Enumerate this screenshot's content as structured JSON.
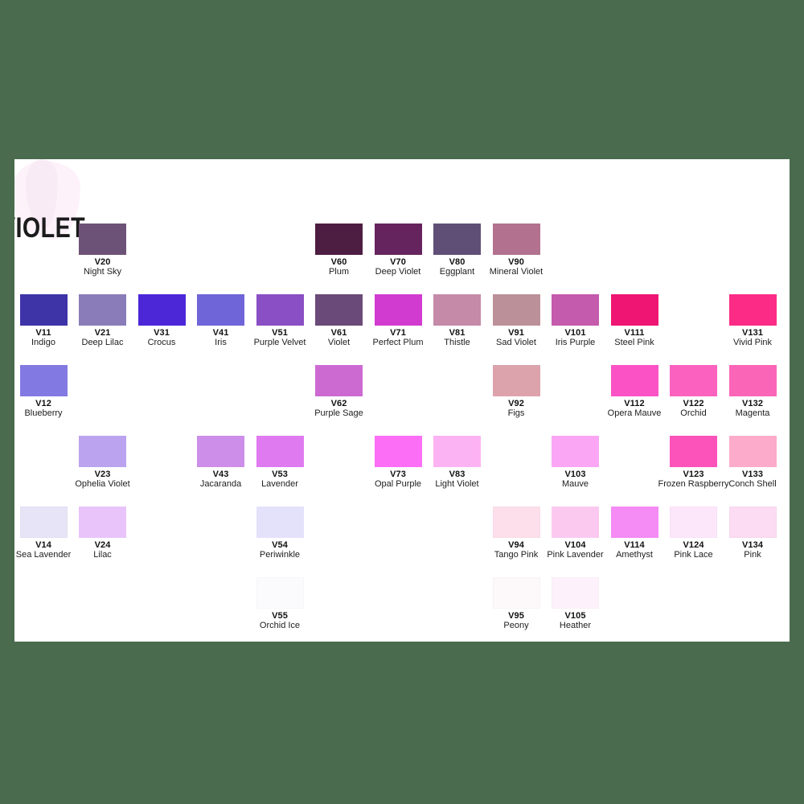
{
  "page": {
    "background_color": "#4a6b4e",
    "card_color": "#ffffff"
  },
  "heading": {
    "text": "VIOLET",
    "color": "#1b1b1b",
    "note": "clipped at left card edge"
  },
  "layout": {
    "columns": 12,
    "rows": 6,
    "chip_width": 59,
    "chip_height": 39,
    "col_pitch": 73.5,
    "row_pitch": 88
  },
  "swatches": [
    {
      "code": "V20",
      "name": "Night Sky",
      "hex": "#6d5277",
      "col": 1,
      "row": 0
    },
    {
      "code": "V60",
      "name": "Plum",
      "hex": "#4e1d42",
      "col": 5,
      "row": 0
    },
    {
      "code": "V70",
      "name": "Deep Violet",
      "hex": "#66245e",
      "col": 6,
      "row": 0
    },
    {
      "code": "V80",
      "name": "Eggplant",
      "hex": "#5f4f77",
      "col": 7,
      "row": 0
    },
    {
      "code": "V90",
      "name": "Mineral Violet",
      "hex": "#b1718f",
      "col": 8,
      "row": 0
    },
    {
      "code": "V11",
      "name": "Indigo",
      "hex": "#3e34a8",
      "col": 0,
      "row": 1
    },
    {
      "code": "V21",
      "name": "Deep Lilac",
      "hex": "#8a7cb8",
      "col": 1,
      "row": 1
    },
    {
      "code": "V31",
      "name": "Crocus",
      "hex": "#4b27d8",
      "col": 2,
      "row": 1
    },
    {
      "code": "V41",
      "name": "Iris",
      "hex": "#6f64d8",
      "col": 3,
      "row": 1
    },
    {
      "code": "V51",
      "name": "Purple Velvet",
      "hex": "#8a4fc4",
      "col": 4,
      "row": 1
    },
    {
      "code": "V61",
      "name": "Violet",
      "hex": "#6a4a78",
      "col": 5,
      "row": 1
    },
    {
      "code": "V71",
      "name": "Perfect Plum",
      "hex": "#d23bd0",
      "col": 6,
      "row": 1
    },
    {
      "code": "V81",
      "name": "Thistle",
      "hex": "#c58aa7",
      "col": 7,
      "row": 1
    },
    {
      "code": "V91",
      "name": "Sad Violet",
      "hex": "#bb9098",
      "col": 8,
      "row": 1
    },
    {
      "code": "V101",
      "name": "Iris Purple",
      "hex": "#c45bad",
      "col": 9,
      "row": 1
    },
    {
      "code": "V111",
      "name": "Steel Pink",
      "hex": "#ef1573",
      "col": 10,
      "row": 1
    },
    {
      "code": "V131",
      "name": "Vivid Pink",
      "hex": "#fb2b86",
      "col": 12,
      "row": 1
    },
    {
      "code": "V12",
      "name": "Blueberry",
      "hex": "#8379e2",
      "col": 0,
      "row": 2
    },
    {
      "code": "V62",
      "name": "Purple Sage",
      "hex": "#cd6ad2",
      "col": 5,
      "row": 2
    },
    {
      "code": "V92",
      "name": "Figs",
      "hex": "#dca3ad",
      "col": 8,
      "row": 2
    },
    {
      "code": "V112",
      "name": "Opera Mauve",
      "hex": "#fb52c6",
      "col": 10,
      "row": 2
    },
    {
      "code": "V122",
      "name": "Orchid",
      "hex": "#fb62bf",
      "col": 11,
      "row": 2
    },
    {
      "code": "V132",
      "name": "Magenta",
      "hex": "#fb65b8",
      "col": 12,
      "row": 2
    },
    {
      "code": "V23",
      "name": "Ophelia Violet",
      "hex": "#bba3f0",
      "col": 1,
      "row": 3
    },
    {
      "code": "V43",
      "name": "Jacaranda",
      "hex": "#cc8ee8",
      "col": 3,
      "row": 3
    },
    {
      "code": "V53",
      "name": "Lavender",
      "hex": "#e07af0",
      "col": 4,
      "row": 3
    },
    {
      "code": "V73",
      "name": "Opal Purple",
      "hex": "#fb6ef5",
      "col": 6,
      "row": 3
    },
    {
      "code": "V83",
      "name": "Light Violet",
      "hex": "#fcb3f3",
      "col": 7,
      "row": 3
    },
    {
      "code": "V103",
      "name": "Mauve",
      "hex": "#fba6f4",
      "col": 9,
      "row": 3
    },
    {
      "code": "V123",
      "name": "Frozen Raspberry",
      "hex": "#fb53b9",
      "col": 11,
      "row": 3
    },
    {
      "code": "V133",
      "name": "Conch Shell",
      "hex": "#fdabca",
      "col": 12,
      "row": 3
    },
    {
      "code": "V14",
      "name": "Sea Lavender",
      "hex": "#e7e4f7",
      "col": 0,
      "row": 4
    },
    {
      "code": "V24",
      "name": "Lilac",
      "hex": "#e8c4fa",
      "col": 1,
      "row": 4
    },
    {
      "code": "V54",
      "name": "Periwinkle",
      "hex": "#e4e1fb",
      "col": 4,
      "row": 4
    },
    {
      "code": "V94",
      "name": "Tango Pink",
      "hex": "#fcdfeb",
      "col": 8,
      "row": 4
    },
    {
      "code": "V104",
      "name": "Pink Lavender",
      "hex": "#fbc9f0",
      "col": 9,
      "row": 4
    },
    {
      "code": "V114",
      "name": "Amethyst",
      "hex": "#f58bf4",
      "col": 10,
      "row": 4
    },
    {
      "code": "V124",
      "name": "Pink Lace",
      "hex": "#fce6fa",
      "col": 11,
      "row": 4
    },
    {
      "code": "V134",
      "name": "Pink",
      "hex": "#fbdcf2",
      "col": 12,
      "row": 4
    },
    {
      "code": "V55",
      "name": "Orchid Ice",
      "hex": "#fbfbfd",
      "col": 4,
      "row": 5
    },
    {
      "code": "V95",
      "name": "Peony",
      "hex": "#fdf8fa",
      "col": 8,
      "row": 5
    },
    {
      "code": "V105",
      "name": "Heather",
      "hex": "#fdf2fb",
      "col": 9,
      "row": 5
    }
  ]
}
